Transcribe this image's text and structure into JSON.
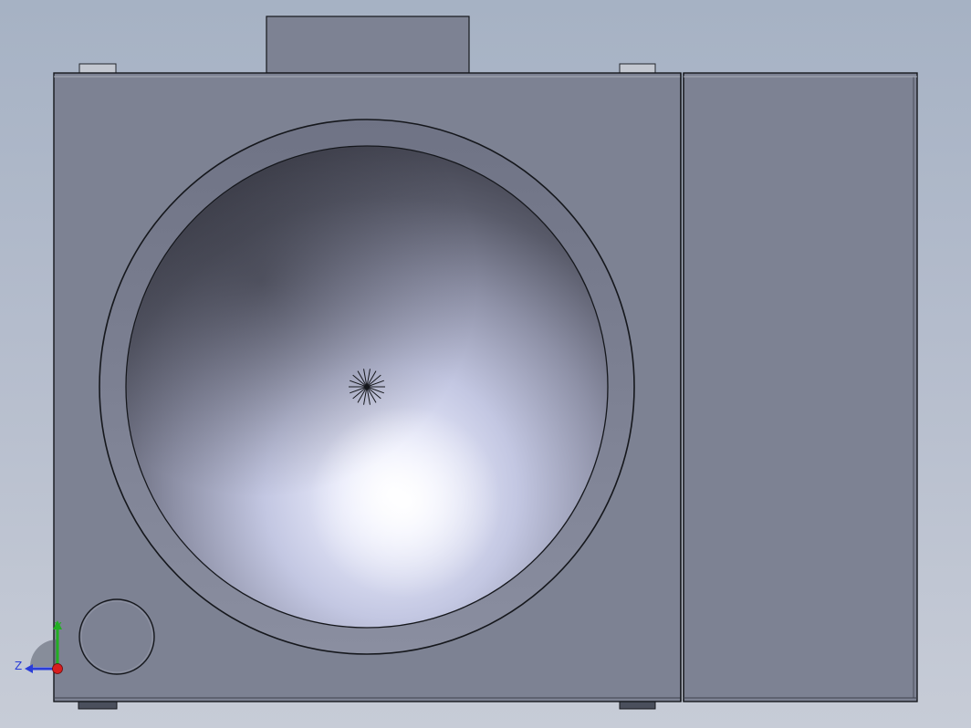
{
  "viewport": {
    "background_top": "#a6b2c4",
    "background_bottom": "#c7ccd7",
    "model_face_color": "#7d8293",
    "model_edge_color": "#15171c",
    "bowl_highlight_color": "#f2f4ff",
    "bowl_shadow_color": "#3b3d48"
  },
  "triad": {
    "z_label": "Z",
    "y_label": "Y",
    "z_axis_color": "#2a3dd8",
    "y_axis_color": "#22b022",
    "x_axis_color": "#d81e1e"
  }
}
